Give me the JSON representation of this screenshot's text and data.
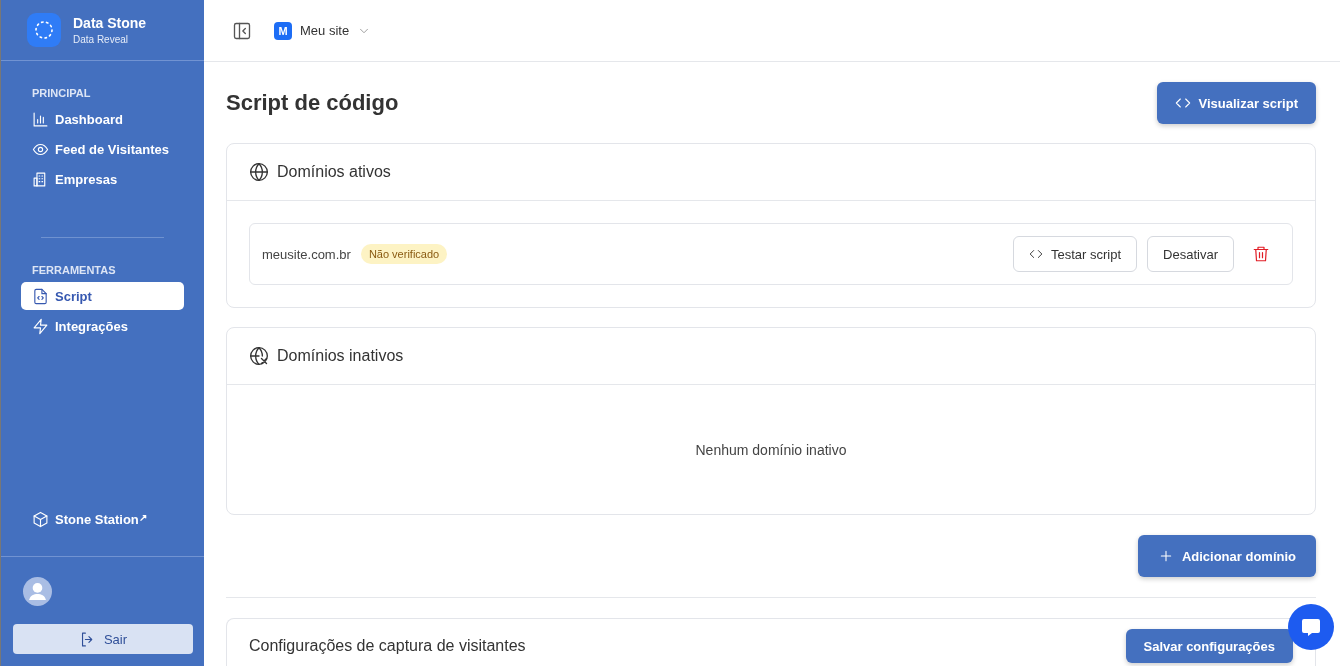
{
  "brand": {
    "name": "Data Stone",
    "subtitle": "Data Reveal"
  },
  "sidebar": {
    "sections": [
      {
        "title": "PRINCIPAL",
        "items": [
          {
            "label": "Dashboard",
            "selected": false
          },
          {
            "label": "Feed de Visitantes",
            "selected": false
          },
          {
            "label": "Empresas",
            "selected": false
          }
        ]
      },
      {
        "title": "FERRAMENTAS",
        "items": [
          {
            "label": "Script",
            "selected": true
          },
          {
            "label": "Integrações",
            "selected": false
          }
        ]
      }
    ],
    "external_link": {
      "label": "Stone Station",
      "arrow": "↗"
    },
    "logout": "Sair"
  },
  "topbar": {
    "site_badge": "M",
    "site_name": "Meu site"
  },
  "page": {
    "title": "Script de código",
    "action": "Visualizar script"
  },
  "active_domains": {
    "title": "Domínios ativos",
    "domains": [
      {
        "domain": "meusite.com.br",
        "status": "Não verificado",
        "verified": false,
        "actions": [
          "Testar script",
          "Desativar"
        ]
      }
    ]
  },
  "inactive_domains": {
    "title": "Domínios inativos",
    "empty_text": "Nenhum domínio inativo"
  },
  "add_button": "Adicionar domínio",
  "capture_settings": {
    "title": "Configurações de captura de visitantes",
    "action": "Salvar configurações"
  }
}
